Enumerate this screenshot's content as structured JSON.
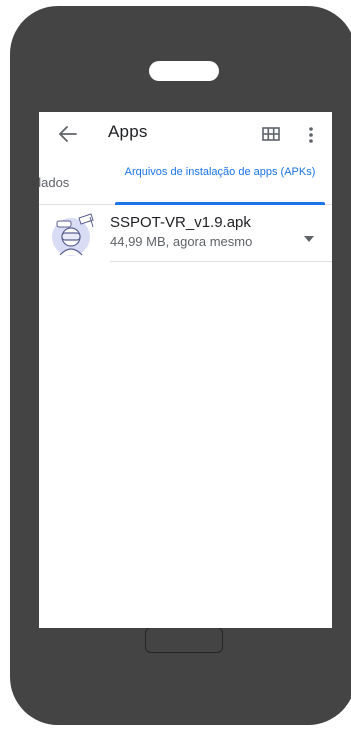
{
  "appbar": {
    "title": "Apps",
    "back_icon": "arrow-back-icon",
    "view_icon": "grid-view-icon",
    "more_icon": "more-vert-icon"
  },
  "tabs": {
    "installed_label": "alados",
    "apks_label": "Arquivos de instalação de apps (APKs)",
    "active_color": "#1a73e8"
  },
  "files": [
    {
      "name": "SSPOT-VR_v1.9.apk",
      "meta": "44,99 MB, agora mesmo",
      "thumbnail_icon": "vr-student-icon",
      "action_icon": "dropdown-arrow-icon"
    }
  ],
  "colors": {
    "phone_body": "#444444",
    "screen": "#ffffff",
    "accent": "#1a73e8"
  }
}
